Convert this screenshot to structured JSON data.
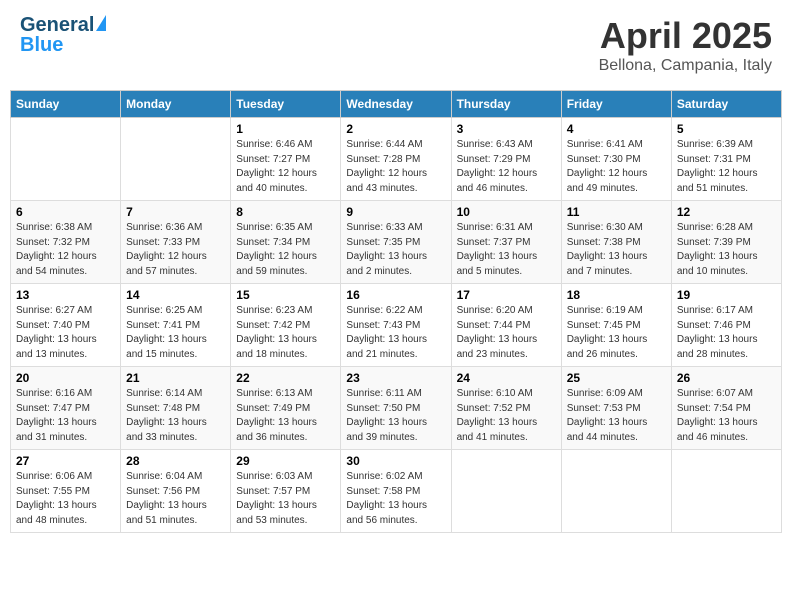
{
  "header": {
    "logo_general": "General",
    "logo_blue": "Blue",
    "month_title": "April 2025",
    "location": "Bellona, Campania, Italy"
  },
  "days_of_week": [
    "Sunday",
    "Monday",
    "Tuesday",
    "Wednesday",
    "Thursday",
    "Friday",
    "Saturday"
  ],
  "weeks": [
    [
      {
        "day": "",
        "info": ""
      },
      {
        "day": "",
        "info": ""
      },
      {
        "day": "1",
        "info": "Sunrise: 6:46 AM\nSunset: 7:27 PM\nDaylight: 12 hours and 40 minutes."
      },
      {
        "day": "2",
        "info": "Sunrise: 6:44 AM\nSunset: 7:28 PM\nDaylight: 12 hours and 43 minutes."
      },
      {
        "day": "3",
        "info": "Sunrise: 6:43 AM\nSunset: 7:29 PM\nDaylight: 12 hours and 46 minutes."
      },
      {
        "day": "4",
        "info": "Sunrise: 6:41 AM\nSunset: 7:30 PM\nDaylight: 12 hours and 49 minutes."
      },
      {
        "day": "5",
        "info": "Sunrise: 6:39 AM\nSunset: 7:31 PM\nDaylight: 12 hours and 51 minutes."
      }
    ],
    [
      {
        "day": "6",
        "info": "Sunrise: 6:38 AM\nSunset: 7:32 PM\nDaylight: 12 hours and 54 minutes."
      },
      {
        "day": "7",
        "info": "Sunrise: 6:36 AM\nSunset: 7:33 PM\nDaylight: 12 hours and 57 minutes."
      },
      {
        "day": "8",
        "info": "Sunrise: 6:35 AM\nSunset: 7:34 PM\nDaylight: 12 hours and 59 minutes."
      },
      {
        "day": "9",
        "info": "Sunrise: 6:33 AM\nSunset: 7:35 PM\nDaylight: 13 hours and 2 minutes."
      },
      {
        "day": "10",
        "info": "Sunrise: 6:31 AM\nSunset: 7:37 PM\nDaylight: 13 hours and 5 minutes."
      },
      {
        "day": "11",
        "info": "Sunrise: 6:30 AM\nSunset: 7:38 PM\nDaylight: 13 hours and 7 minutes."
      },
      {
        "day": "12",
        "info": "Sunrise: 6:28 AM\nSunset: 7:39 PM\nDaylight: 13 hours and 10 minutes."
      }
    ],
    [
      {
        "day": "13",
        "info": "Sunrise: 6:27 AM\nSunset: 7:40 PM\nDaylight: 13 hours and 13 minutes."
      },
      {
        "day": "14",
        "info": "Sunrise: 6:25 AM\nSunset: 7:41 PM\nDaylight: 13 hours and 15 minutes."
      },
      {
        "day": "15",
        "info": "Sunrise: 6:23 AM\nSunset: 7:42 PM\nDaylight: 13 hours and 18 minutes."
      },
      {
        "day": "16",
        "info": "Sunrise: 6:22 AM\nSunset: 7:43 PM\nDaylight: 13 hours and 21 minutes."
      },
      {
        "day": "17",
        "info": "Sunrise: 6:20 AM\nSunset: 7:44 PM\nDaylight: 13 hours and 23 minutes."
      },
      {
        "day": "18",
        "info": "Sunrise: 6:19 AM\nSunset: 7:45 PM\nDaylight: 13 hours and 26 minutes."
      },
      {
        "day": "19",
        "info": "Sunrise: 6:17 AM\nSunset: 7:46 PM\nDaylight: 13 hours and 28 minutes."
      }
    ],
    [
      {
        "day": "20",
        "info": "Sunrise: 6:16 AM\nSunset: 7:47 PM\nDaylight: 13 hours and 31 minutes."
      },
      {
        "day": "21",
        "info": "Sunrise: 6:14 AM\nSunset: 7:48 PM\nDaylight: 13 hours and 33 minutes."
      },
      {
        "day": "22",
        "info": "Sunrise: 6:13 AM\nSunset: 7:49 PM\nDaylight: 13 hours and 36 minutes."
      },
      {
        "day": "23",
        "info": "Sunrise: 6:11 AM\nSunset: 7:50 PM\nDaylight: 13 hours and 39 minutes."
      },
      {
        "day": "24",
        "info": "Sunrise: 6:10 AM\nSunset: 7:52 PM\nDaylight: 13 hours and 41 minutes."
      },
      {
        "day": "25",
        "info": "Sunrise: 6:09 AM\nSunset: 7:53 PM\nDaylight: 13 hours and 44 minutes."
      },
      {
        "day": "26",
        "info": "Sunrise: 6:07 AM\nSunset: 7:54 PM\nDaylight: 13 hours and 46 minutes."
      }
    ],
    [
      {
        "day": "27",
        "info": "Sunrise: 6:06 AM\nSunset: 7:55 PM\nDaylight: 13 hours and 48 minutes."
      },
      {
        "day": "28",
        "info": "Sunrise: 6:04 AM\nSunset: 7:56 PM\nDaylight: 13 hours and 51 minutes."
      },
      {
        "day": "29",
        "info": "Sunrise: 6:03 AM\nSunset: 7:57 PM\nDaylight: 13 hours and 53 minutes."
      },
      {
        "day": "30",
        "info": "Sunrise: 6:02 AM\nSunset: 7:58 PM\nDaylight: 13 hours and 56 minutes."
      },
      {
        "day": "",
        "info": ""
      },
      {
        "day": "",
        "info": ""
      },
      {
        "day": "",
        "info": ""
      }
    ]
  ]
}
